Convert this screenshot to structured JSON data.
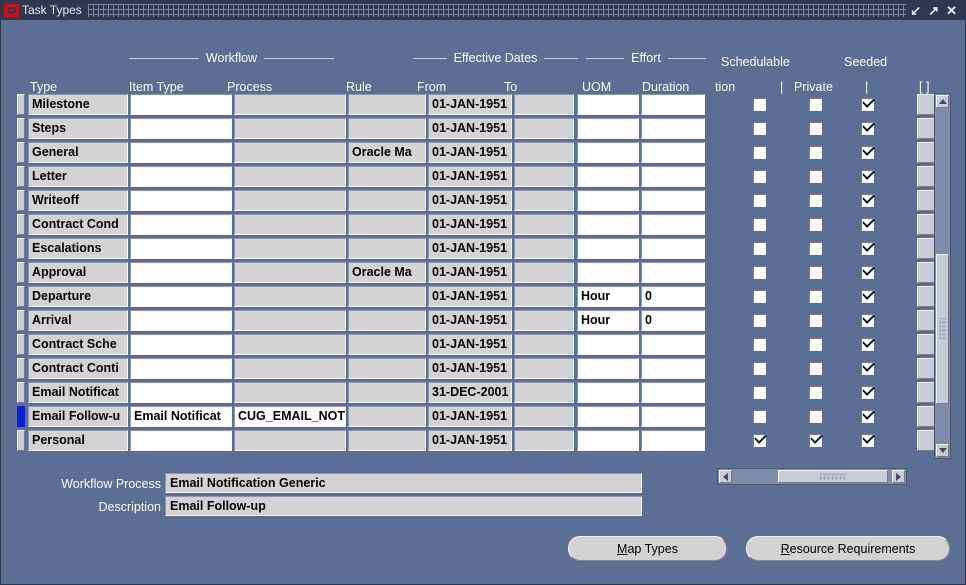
{
  "window": {
    "title": "Task Types",
    "logo_icon": "oracle-logo-icon",
    "controls": [
      {
        "name": "minimize-button",
        "glyph": "↙"
      },
      {
        "name": "maximize-button",
        "glyph": "↗"
      },
      {
        "name": "close-button",
        "glyph": "✕"
      }
    ]
  },
  "group_headers": {
    "workflow": "Workflow",
    "effective_dates": "Effective Dates",
    "effort": "Effort",
    "schedulable": "Schedulable",
    "seeded": "Seeded"
  },
  "columns": {
    "type": "Type",
    "item_type": "Item Type",
    "process": "Process",
    "rule": "Rule",
    "from": "From",
    "to": "To",
    "uom": "UOM",
    "duration": "Duration",
    "tion": "tion",
    "bar1": "|",
    "private": "Private",
    "bar2": "|",
    "brackets": "[ ]"
  },
  "rows": [
    {
      "type": "Milestone",
      "item_type": "",
      "process": "",
      "rule": "",
      "from": "01-JAN-1951",
      "to": "",
      "uom": "",
      "duration": "",
      "schedulable": false,
      "private": false,
      "seeded": true,
      "selected": false,
      "editable_process": false
    },
    {
      "type": "Steps",
      "item_type": "",
      "process": "",
      "rule": "",
      "from": "01-JAN-1951",
      "to": "",
      "uom": "",
      "duration": "",
      "schedulable": false,
      "private": false,
      "seeded": true,
      "selected": false,
      "editable_process": false
    },
    {
      "type": "General",
      "item_type": "",
      "process": "",
      "rule": "Oracle Ma",
      "from": "01-JAN-1951",
      "to": "",
      "uom": "",
      "duration": "",
      "schedulable": false,
      "private": false,
      "seeded": true,
      "selected": false,
      "editable_process": false
    },
    {
      "type": "Letter",
      "item_type": "",
      "process": "",
      "rule": "",
      "from": "01-JAN-1951",
      "to": "",
      "uom": "",
      "duration": "",
      "schedulable": false,
      "private": false,
      "seeded": true,
      "selected": false,
      "editable_process": false
    },
    {
      "type": "Writeoff",
      "item_type": "",
      "process": "",
      "rule": "",
      "from": "01-JAN-1951",
      "to": "",
      "uom": "",
      "duration": "",
      "schedulable": false,
      "private": false,
      "seeded": true,
      "selected": false,
      "editable_process": false
    },
    {
      "type": "Contract Cond",
      "item_type": "",
      "process": "",
      "rule": "",
      "from": "01-JAN-1951",
      "to": "",
      "uom": "",
      "duration": "",
      "schedulable": false,
      "private": false,
      "seeded": true,
      "selected": false,
      "editable_process": false
    },
    {
      "type": "Escalations",
      "item_type": "",
      "process": "",
      "rule": "",
      "from": "01-JAN-1951",
      "to": "",
      "uom": "",
      "duration": "",
      "schedulable": false,
      "private": false,
      "seeded": true,
      "selected": false,
      "editable_process": false
    },
    {
      "type": "Approval",
      "item_type": "",
      "process": "",
      "rule": "Oracle Ma",
      "from": "01-JAN-1951",
      "to": "",
      "uom": "",
      "duration": "",
      "schedulable": false,
      "private": false,
      "seeded": true,
      "selected": false,
      "editable_process": false
    },
    {
      "type": "Departure",
      "item_type": "",
      "process": "",
      "rule": "",
      "from": "01-JAN-1951",
      "to": "",
      "uom": "Hour",
      "duration": "0",
      "schedulable": false,
      "private": false,
      "seeded": true,
      "selected": false,
      "editable_process": false
    },
    {
      "type": "Arrival",
      "item_type": "",
      "process": "",
      "rule": "",
      "from": "01-JAN-1951",
      "to": "",
      "uom": "Hour",
      "duration": "0",
      "schedulable": false,
      "private": false,
      "seeded": true,
      "selected": false,
      "editable_process": false
    },
    {
      "type": "Contract Sche",
      "item_type": "",
      "process": "",
      "rule": "",
      "from": "01-JAN-1951",
      "to": "",
      "uom": "",
      "duration": "",
      "schedulable": false,
      "private": false,
      "seeded": true,
      "selected": false,
      "editable_process": false
    },
    {
      "type": "Contract Conti",
      "item_type": "",
      "process": "",
      "rule": "",
      "from": "01-JAN-1951",
      "to": "",
      "uom": "",
      "duration": "",
      "schedulable": false,
      "private": false,
      "seeded": true,
      "selected": false,
      "editable_process": false
    },
    {
      "type": "Email Notificat",
      "item_type": "",
      "process": "",
      "rule": "",
      "from": "31-DEC-2001",
      "to": "",
      "uom": "",
      "duration": "",
      "schedulable": false,
      "private": false,
      "seeded": true,
      "selected": false,
      "editable_process": false
    },
    {
      "type": "Email Follow-u",
      "item_type": "Email Notificat",
      "process": "CUG_EMAIL_NOTI",
      "rule": "",
      "from": "01-JAN-1951",
      "to": "",
      "uom": "",
      "duration": "",
      "schedulable": false,
      "private": false,
      "seeded": true,
      "selected": true,
      "editable_process": true
    },
    {
      "type": "Personal",
      "item_type": "",
      "process": "",
      "rule": "",
      "from": "01-JAN-1951",
      "to": "",
      "uom": "",
      "duration": "",
      "schedulable": true,
      "private": true,
      "seeded": true,
      "selected": false,
      "editable_process": false
    }
  ],
  "detail": {
    "workflow_process_label": "Workflow Process",
    "workflow_process_value": "Email Notification Generic",
    "description_label": "Description",
    "description_value": "Email Follow-up"
  },
  "buttons": {
    "map_types": {
      "mnemonic": "M",
      "rest": "ap Types"
    },
    "resource_requirements": {
      "mnemonic": "R",
      "rest": "esource Requirements"
    }
  },
  "colors": {
    "background": "#5b6f94",
    "titlebar": "#2c3950",
    "field": "#d3d3d3",
    "field_editable": "#ffffff",
    "selection": "#0d1fd4",
    "logo_red": "#cf0d1c"
  }
}
